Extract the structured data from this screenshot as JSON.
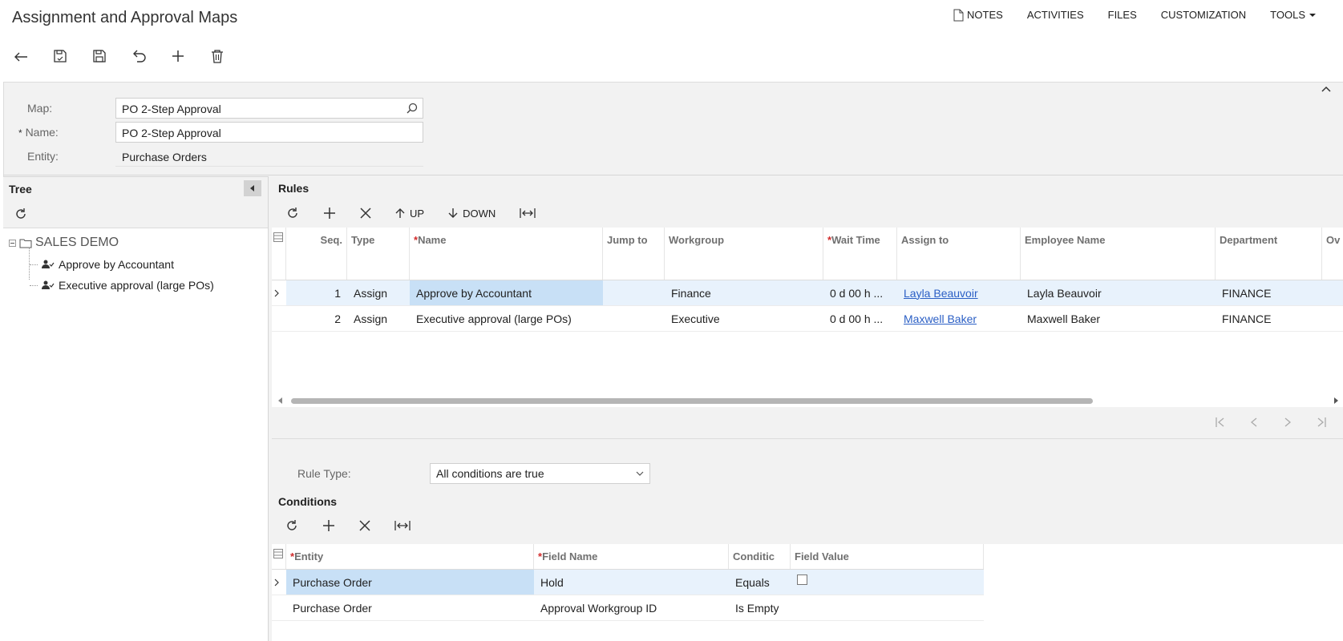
{
  "page": {
    "title": "Assignment and Approval Maps"
  },
  "top_menu": {
    "notes": "NOTES",
    "activities": "ACTIVITIES",
    "files": "FILES",
    "customization": "CUSTOMIZATION",
    "tools": "TOOLS"
  },
  "form": {
    "map_label": "Map:",
    "map_value": "PO 2-Step Approval",
    "name_label": "Name:",
    "name_required": "*",
    "name_value": "PO 2-Step Approval",
    "entity_label": "Entity:",
    "entity_value": "Purchase Orders"
  },
  "tree": {
    "title": "Tree",
    "root": "SALES DEMO",
    "items": [
      {
        "label": "Approve by Accountant"
      },
      {
        "label": "Executive approval (large POs)"
      }
    ]
  },
  "rules": {
    "title": "Rules",
    "up_label": "UP",
    "down_label": "DOWN",
    "columns": {
      "seq": "Seq.",
      "type": "Type",
      "name": "Name",
      "jump_to": "Jump to",
      "workgroup": "Workgroup",
      "wait_time": "Wait Time",
      "assign_to": "Assign to",
      "employee_name": "Employee Name",
      "department": "Department",
      "overflow": "Ov"
    },
    "rows": [
      {
        "seq": "1",
        "type": "Assign",
        "name": "Approve by Accountant",
        "jump_to": "",
        "workgroup": "Finance",
        "wait_time": "0 d 00 h ...",
        "assign_to": "Layla Beauvoir",
        "employee_name": "Layla Beauvoir",
        "department": "FINANCE"
      },
      {
        "seq": "2",
        "type": "Assign",
        "name": "Executive approval (large POs)",
        "jump_to": "",
        "workgroup": "Executive",
        "wait_time": "0 d 00 h ...",
        "assign_to": "Maxwell Baker",
        "employee_name": "Maxwell Baker",
        "department": "FINANCE"
      }
    ]
  },
  "rule_type": {
    "label": "Rule Type:",
    "value": "All conditions are true"
  },
  "conditions": {
    "title": "Conditions",
    "columns": {
      "entity": "Entity",
      "field_name": "Field Name",
      "condition": "Conditic",
      "field_value": "Field Value"
    },
    "rows": [
      {
        "entity": "Purchase Order",
        "field_name": "Hold",
        "condition": "Equals",
        "checkbox": true
      },
      {
        "entity": "Purchase Order",
        "field_name": "Approval Workgroup ID",
        "condition": "Is Empty",
        "checkbox": false
      }
    ]
  },
  "colors": {
    "link": "#2b5fc5",
    "required": "#d12b2b",
    "selected_row": "#e8f2fc",
    "active_cell": "#c8e0f6"
  }
}
